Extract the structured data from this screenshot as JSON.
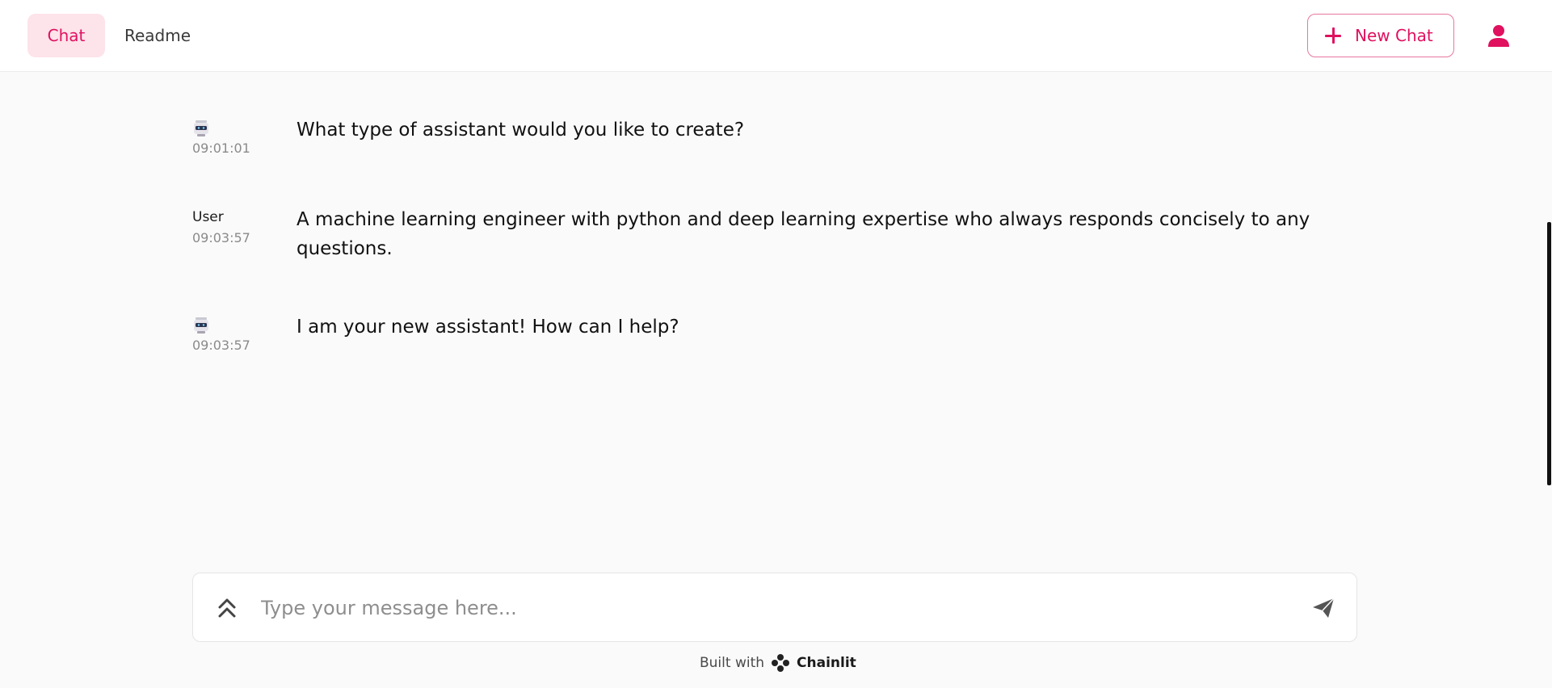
{
  "header": {
    "tabs": [
      {
        "label": "Chat",
        "active": true
      },
      {
        "label": "Readme",
        "active": false
      }
    ],
    "new_chat_label": "New Chat",
    "accent_color": "#e0115f"
  },
  "messages": [
    {
      "author": "",
      "author_icon": "robot-avatar-icon",
      "time": "09:01:01",
      "text": "What type of assistant would you like to create?"
    },
    {
      "author": "User",
      "author_icon": "",
      "time": "09:03:57",
      "text": "A machine learning engineer with python and deep learning expertise who always responds concisely to any questions."
    },
    {
      "author": "",
      "author_icon": "robot-avatar-icon",
      "time": "09:03:57",
      "text": "I am your new assistant! How can I help?"
    }
  ],
  "composer": {
    "placeholder": "Type your message here...",
    "value": ""
  },
  "footer": {
    "built_with": "Built with",
    "brand": "Chainlit"
  }
}
